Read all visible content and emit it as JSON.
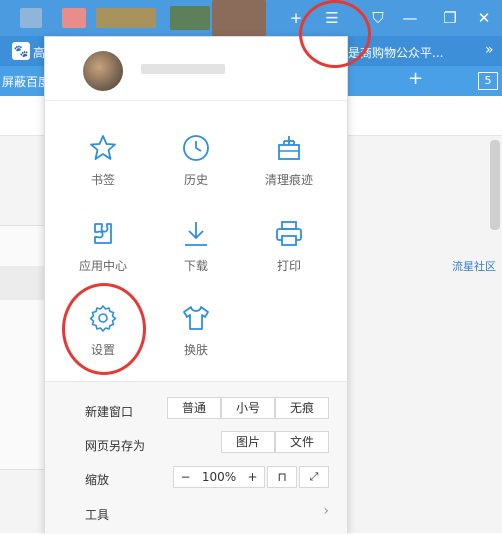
{
  "top_bar": {
    "bookmark_partial": "高",
    "page_partial_left": "屏蔽百度",
    "shopping_link": "是商购物公众平...",
    "new_tab_button": "+",
    "tab_count": "5"
  },
  "menu": {
    "grid": [
      {
        "label": "书签"
      },
      {
        "label": "历史"
      },
      {
        "label": "清理痕迹"
      },
      {
        "label": "应用中心"
      },
      {
        "label": "下载"
      },
      {
        "label": "打印"
      },
      {
        "label": "设置"
      },
      {
        "label": "换肤"
      }
    ],
    "new_window": {
      "label": "新建窗口",
      "options": [
        "普通",
        "小号",
        "无痕"
      ]
    },
    "save_as": {
      "label": "网页另存为",
      "options": [
        "图片",
        "文件"
      ]
    },
    "zoom": {
      "label": "缩放",
      "minus": "−",
      "value": "100%",
      "plus": "+"
    },
    "tools": {
      "label": "工具"
    }
  },
  "side_link": "流星社区",
  "colors": {
    "accent": "#2d8fe0",
    "annotation": "#e53935"
  }
}
